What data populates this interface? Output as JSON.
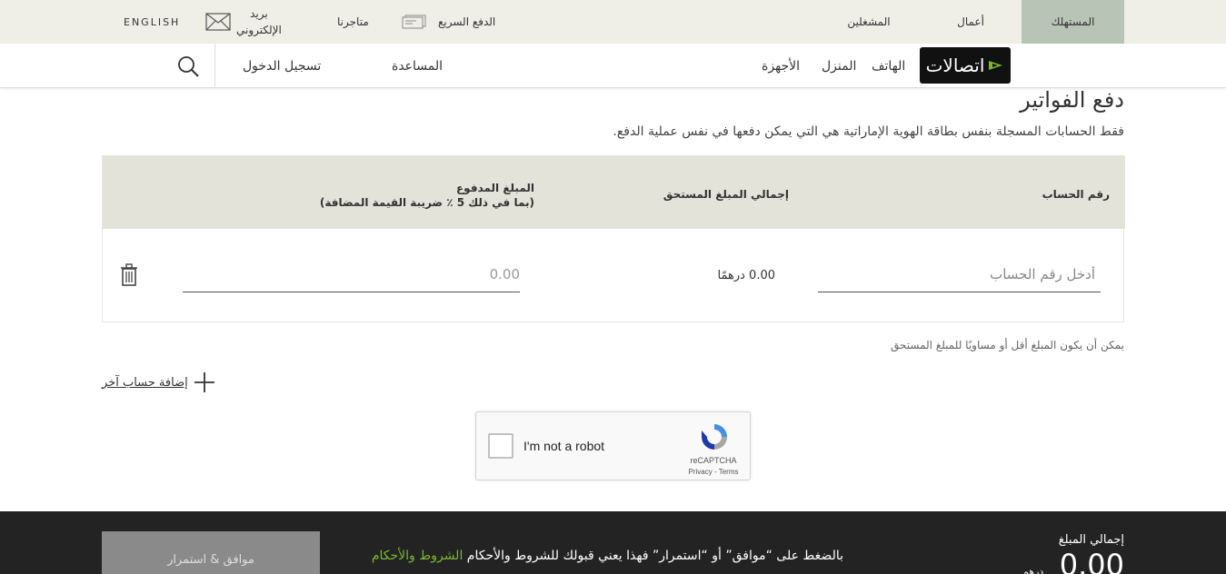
{
  "topbar": {
    "tabs": [
      {
        "label": "المستهلك",
        "active": true
      },
      {
        "label": "أعمال",
        "active": false
      },
      {
        "label": "المشغلين",
        "active": false
      }
    ],
    "quick_pay": "الدفع السريع",
    "stores": "متاجرنا",
    "email_line1": "بريد",
    "email_line2": "الإلكتروني",
    "language": "ENGLISH"
  },
  "nav": {
    "logo_text": "اتصالات",
    "items": [
      "الهاتف",
      "المنزل",
      "الأجهزة"
    ],
    "help": "المساعدة",
    "login": "تسجيل الدخول"
  },
  "page": {
    "title": "دفع الفواتير",
    "description": "فقط الحسابات المسجلة بنفس بطاقة الهوية الإماراتية هي التي يمكن دفعها في نفس عملية الدفع."
  },
  "table": {
    "col_account": "رقم الحساب",
    "col_total_due": "إجمالي المبلغ المستحق",
    "col_paid_line1": "المبلغ المدفوع",
    "col_paid_line2": "(بما في ذلك 5 ٪ ضريبة القيمة المضافة)",
    "account_placeholder": "أدخل رقم الحساب",
    "due_value": "0.00 درهمًا",
    "paid_placeholder": "0.00"
  },
  "note": "يمكن أن يكون المبلغ أقل أو مساويًا للمبلغ المستحق",
  "add_account": "إضافة حساب آخر",
  "captcha": {
    "label": "I'm not a robot",
    "brand": "reCAPTCHA",
    "links": "Privacy - Terms"
  },
  "footer": {
    "agree_button": "موافق & استمرار",
    "terms_text": "بالضغط على “موافق” أو “استمرار” فهذا يعني قبولك للشروط والأحكام ",
    "terms_link": "الشروط والأحكام",
    "total_label": "إجمالي المبلغ",
    "total_value": "0.00",
    "currency": "درهم"
  },
  "colors": {
    "active_tab": "#b8c4b6",
    "header_bg": "#efefe8",
    "table_head_bg": "#e4e3d9",
    "footer_bg": "#232323",
    "link_green": "#7cb82f"
  }
}
